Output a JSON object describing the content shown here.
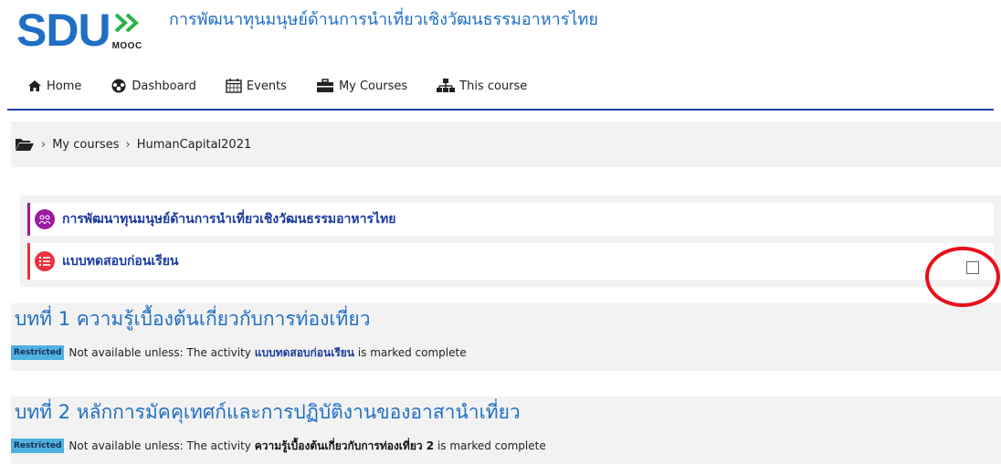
{
  "header": {
    "logo_text": "SDU",
    "logo_sub": "MOOC",
    "site_title": "การพัฒนาทุนมนุษย์ด้านการนำเที่ยวเชิงวัฒนธรรมอาหารไทย",
    "brand_color": "#1f6fc4"
  },
  "nav": {
    "items": [
      {
        "label": "Home",
        "icon": "home-icon"
      },
      {
        "label": "Dashboard",
        "icon": "dashboard-icon"
      },
      {
        "label": "Events",
        "icon": "calendar-icon"
      },
      {
        "label": "My Courses",
        "icon": "briefcase-icon"
      },
      {
        "label": "This course",
        "icon": "sitemap-icon"
      }
    ]
  },
  "breadcrumb": {
    "icon": "folder-open-icon",
    "items": [
      "My courses",
      "HumanCapital2021"
    ]
  },
  "section0": {
    "activities": [
      {
        "label": "การพัฒนาทุนมนุษย์ด้านการนำเที่ยวเชิงวัฒนธรรมอาหารไทย",
        "icon": "forum-icon",
        "color": "#9b1a9f"
      },
      {
        "label": "แบบทดสอบก่อนเรียน",
        "icon": "quiz-icon",
        "color": "#e8323c"
      }
    ]
  },
  "sections": [
    {
      "title": "บทที่ 1 ความรู้เบื้องต้นเกี่ยวกับการท่องเที่ยว",
      "badge": "Restricted",
      "text_before": "Not available unless: The activity",
      "activity": "แบบทดสอบก่อนเรียน",
      "text_after": "is marked complete"
    },
    {
      "title": "บทที่ 2 หลักการมัคคุเทศก์และการปฏิบัติงานของอาสานำเที่ยว",
      "badge": "Restricted",
      "text_before": "Not available unless: The activity",
      "activity": "ความรู้เบื้องต้นเกี่ยวกับการท่องเที่ยว 2",
      "text_after": "is marked complete"
    }
  ]
}
